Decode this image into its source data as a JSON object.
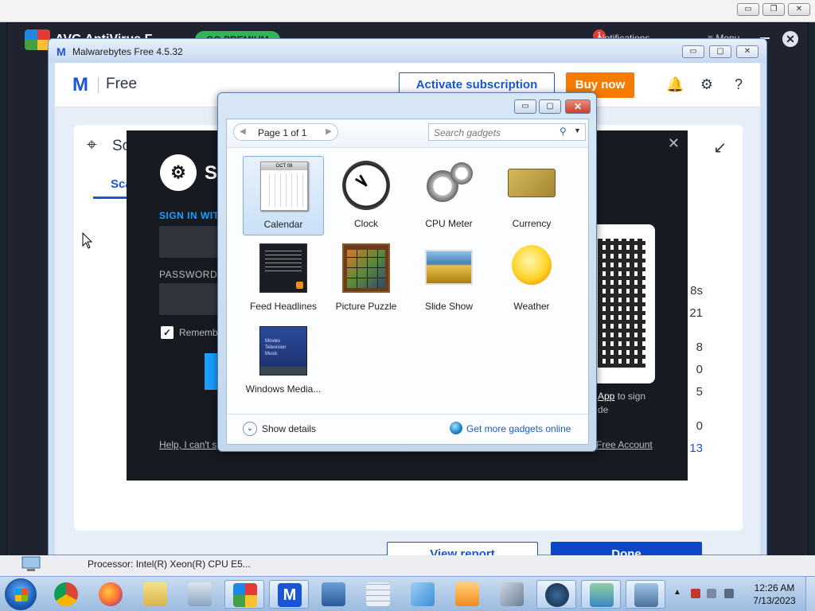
{
  "outer_frame": {
    "min": "▭",
    "restore": "❐",
    "close": "✕"
  },
  "avg": {
    "title": "AVG AntiVirus F...",
    "premium": "GO PREMIUM",
    "notif_badge": "1",
    "notifications": "Notifications",
    "menu": "≡ Menu",
    "close": "✕"
  },
  "malwarebytes": {
    "title": "Malwarebytes Free  4.5.32",
    "free_label": "Free",
    "activate": "Activate subscription",
    "buy_now": "Buy now",
    "scan_title": "Sc",
    "tab_label": "Sca",
    "right_values": [
      "8s",
      "21",
      "8",
      "0",
      "5",
      "0",
      "13"
    ],
    "view_report": "View report",
    "done": "Done",
    "processor_label": "Processor:",
    "processor_value": "Intel(R) Xeon(R) CPU E5..."
  },
  "steam": {
    "logo_text": "S",
    "sign_in": "SIGN IN WIT",
    "password": "PASSWORD",
    "remember": "Rememb",
    "help": "Help, I can't s",
    "app_link": "App",
    "app_text_suffix": " to sign",
    "app_text_line2": "de",
    "free_account": "Free Account",
    "close": "✕"
  },
  "gadgets": {
    "page_label": "Page 1 of 1",
    "search_placeholder": "Search gadgets",
    "show_details": "Show details",
    "get_more": "Get more gadgets online",
    "items": [
      {
        "label": "Calendar"
      },
      {
        "label": "Clock"
      },
      {
        "label": "CPU Meter"
      },
      {
        "label": "Currency"
      },
      {
        "label": "Feed Headlines"
      },
      {
        "label": "Picture Puzzle"
      },
      {
        "label": "Slide Show"
      },
      {
        "label": "Weather"
      },
      {
        "label": "Windows Media..."
      }
    ],
    "calendar_month": "OCT 08",
    "wmc_text": "Movies\nTelevision\nMusic"
  },
  "taskbar": {
    "time": "12:26 AM",
    "date": "7/13/2023"
  },
  "colors": {
    "malwarebytes_blue": "#1a55d6",
    "buy_now_orange": "#f57c00",
    "steam_blue": "#1a9fff"
  }
}
